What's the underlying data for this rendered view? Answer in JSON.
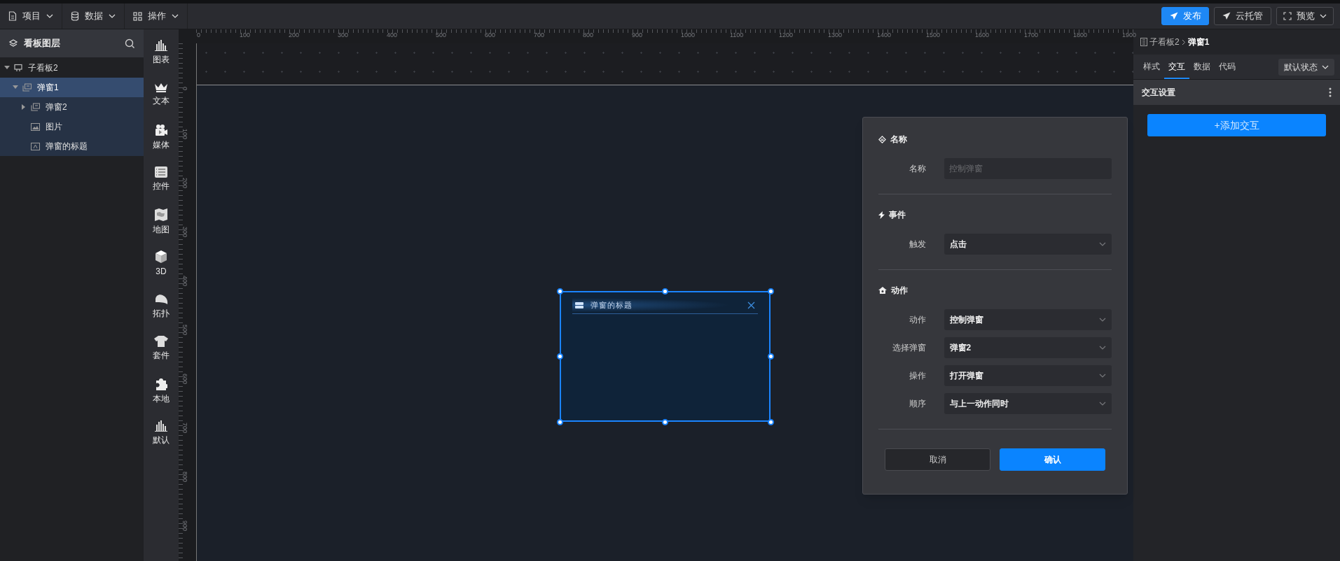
{
  "menu": [
    {
      "label": "项目"
    },
    {
      "label": "数据"
    },
    {
      "label": "操作"
    }
  ],
  "top_actions": [
    {
      "label": "发布",
      "kind": "primary"
    },
    {
      "label": "云托管",
      "kind": "outline"
    },
    {
      "label": "预览",
      "kind": "dropdown"
    }
  ],
  "layers": {
    "title": "看板图层",
    "tree": [
      {
        "label": "子看板2",
        "expanded": true,
        "selected": false,
        "children": [
          {
            "label": "弹窗1",
            "expanded": true,
            "selected": true,
            "children": [
              {
                "label": "弹窗2",
                "expanded": false,
                "selected": false
              },
              {
                "label": "图片",
                "selected": false
              },
              {
                "label": "弹窗的标题",
                "selected": false
              }
            ]
          }
        ]
      }
    ]
  },
  "components": [
    {
      "label": "图表"
    },
    {
      "label": "文本"
    },
    {
      "label": "媒体"
    },
    {
      "label": "控件"
    },
    {
      "label": "地图"
    },
    {
      "label": "3D"
    },
    {
      "label": "拓扑"
    },
    {
      "label": "套件"
    },
    {
      "label": "本地"
    },
    {
      "label": "默认"
    }
  ],
  "ruler": {
    "x_labels": [
      "0",
      "100",
      "200",
      "300",
      "400",
      "500",
      "600",
      "700",
      "800",
      "900",
      "1000",
      "1100",
      "1200",
      "1300",
      "1400",
      "1500",
      "1600",
      "1700",
      "1800",
      "1900"
    ],
    "y_labels": [
      "0",
      "100",
      "200",
      "300",
      "400",
      "500",
      "600",
      "700",
      "800",
      "900"
    ]
  },
  "widget": {
    "title": "弹窗的标题"
  },
  "dialog": {
    "sections": [
      {
        "title": "名称",
        "fields": [
          {
            "label": "名称",
            "kind": "input",
            "placeholder": "控制弹窗"
          }
        ]
      },
      {
        "title": "事件",
        "fields": [
          {
            "label": "触发",
            "kind": "select",
            "value": "点击"
          }
        ]
      },
      {
        "title": "动作",
        "fields": [
          {
            "label": "动作",
            "kind": "select",
            "value": "控制弹窗"
          },
          {
            "label": "选择弹窗",
            "kind": "select",
            "value": "弹窗2"
          },
          {
            "label": "操作",
            "kind": "select",
            "value": "打开弹窗"
          },
          {
            "label": "顺序",
            "kind": "select",
            "value": "与上一动作同时"
          }
        ]
      }
    ],
    "buttons": [
      {
        "label": "取消",
        "kind": "secondary"
      },
      {
        "label": "确认",
        "kind": "primary"
      }
    ]
  },
  "inspector": {
    "breadcrumb": [
      "子看板2",
      "弹窗1"
    ],
    "tabs": [
      {
        "label": "样式",
        "selected": false
      },
      {
        "label": "交互",
        "selected": true
      },
      {
        "label": "数据",
        "selected": false
      },
      {
        "label": "代码",
        "selected": false
      }
    ],
    "state_select": "默认状态",
    "section_title": "交互设置",
    "add_button": "+添加交互"
  }
}
